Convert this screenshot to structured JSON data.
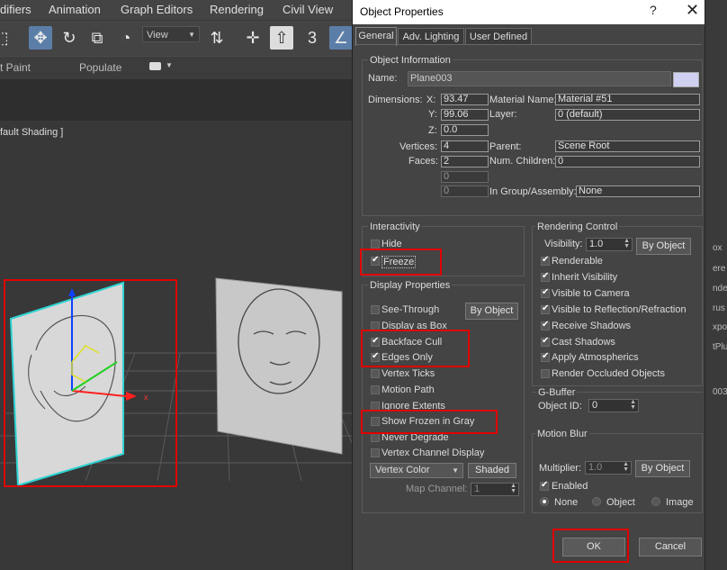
{
  "menubar": {
    "items": [
      "difiers",
      "Animation",
      "Graph Editors",
      "Rendering",
      "Civil View"
    ]
  },
  "toolbar": {
    "view_select": "View"
  },
  "ribbon": {
    "paint_label": "t Paint",
    "populate_label": "Populate"
  },
  "viewport": {
    "label": "fault Shading ]",
    "axis_x": "x"
  },
  "right_panel": {
    "items": [
      "ox",
      "ere",
      "nde",
      "rus",
      "xpo",
      "tPlu",
      "003"
    ]
  },
  "dialog": {
    "title": "Object Properties",
    "help_icon": "?",
    "close_icon": "✕",
    "tabs": [
      "General",
      "Adv. Lighting",
      "User Defined"
    ],
    "object_info": {
      "title": "Object Information",
      "name_label": "Name:",
      "name_value": "Plane003",
      "swatch_color": "#d0d0f0",
      "dimensions_label": "Dimensions:",
      "x_label": "X:",
      "x_value": "93.47",
      "y_label": "Y:",
      "y_value": "99.06",
      "z_label": "Z:",
      "z_value": "0.0",
      "material_name_label": "Material Name:",
      "material_name_value": "Material #51",
      "layer_label": "Layer:",
      "layer_value": "0 (default)",
      "vertices_label": "Vertices:",
      "vertices_value": "4",
      "faces_label": "Faces:",
      "faces_value": "2",
      "extra1_value": "0",
      "extra2_value": "0",
      "parent_label": "Parent:",
      "parent_value": "Scene Root",
      "children_label": "Num. Children:",
      "children_value": "0",
      "group_label": "In Group/Assembly:",
      "group_value": "None"
    },
    "interactivity": {
      "title": "Interactivity",
      "hide_label": "Hide",
      "freeze_label": "Freeze"
    },
    "display": {
      "title": "Display Properties",
      "by_object": "By Object",
      "items": [
        "See-Through",
        "Display as Box",
        "Backface Cull",
        "Edges Only",
        "Vertex Ticks",
        "Motion Path",
        "Ignore Extents",
        "Show Frozen in Gray",
        "Never Degrade",
        "Vertex Channel Display"
      ],
      "vertex_color": "Vertex Color",
      "shaded": "Shaded",
      "map_channel_label": "Map Channel:",
      "map_channel_value": "1"
    },
    "rendering": {
      "title": "Rendering Control",
      "visibility_label": "Visibility:",
      "visibility_value": "1.0",
      "by_object": "By Object",
      "items": [
        "Renderable",
        "Inherit Visibility",
        "Visible to Camera",
        "Visible to Reflection/Refraction",
        "Receive Shadows",
        "Cast Shadows",
        "Apply Atmospherics",
        "Render Occluded Objects"
      ]
    },
    "gbuffer": {
      "title": "G-Buffer",
      "object_id_label": "Object ID:",
      "object_id_value": "0"
    },
    "motion_blur": {
      "title": "Motion Blur",
      "multiplier_label": "Multiplier:",
      "multiplier_value": "1.0",
      "by_object": "By Object",
      "enabled_label": "Enabled",
      "radio_none": "None",
      "radio_object": "Object",
      "radio_image": "Image"
    },
    "ok_label": "OK",
    "cancel_label": "Cancel",
    "highlight_color": "#e00000"
  }
}
